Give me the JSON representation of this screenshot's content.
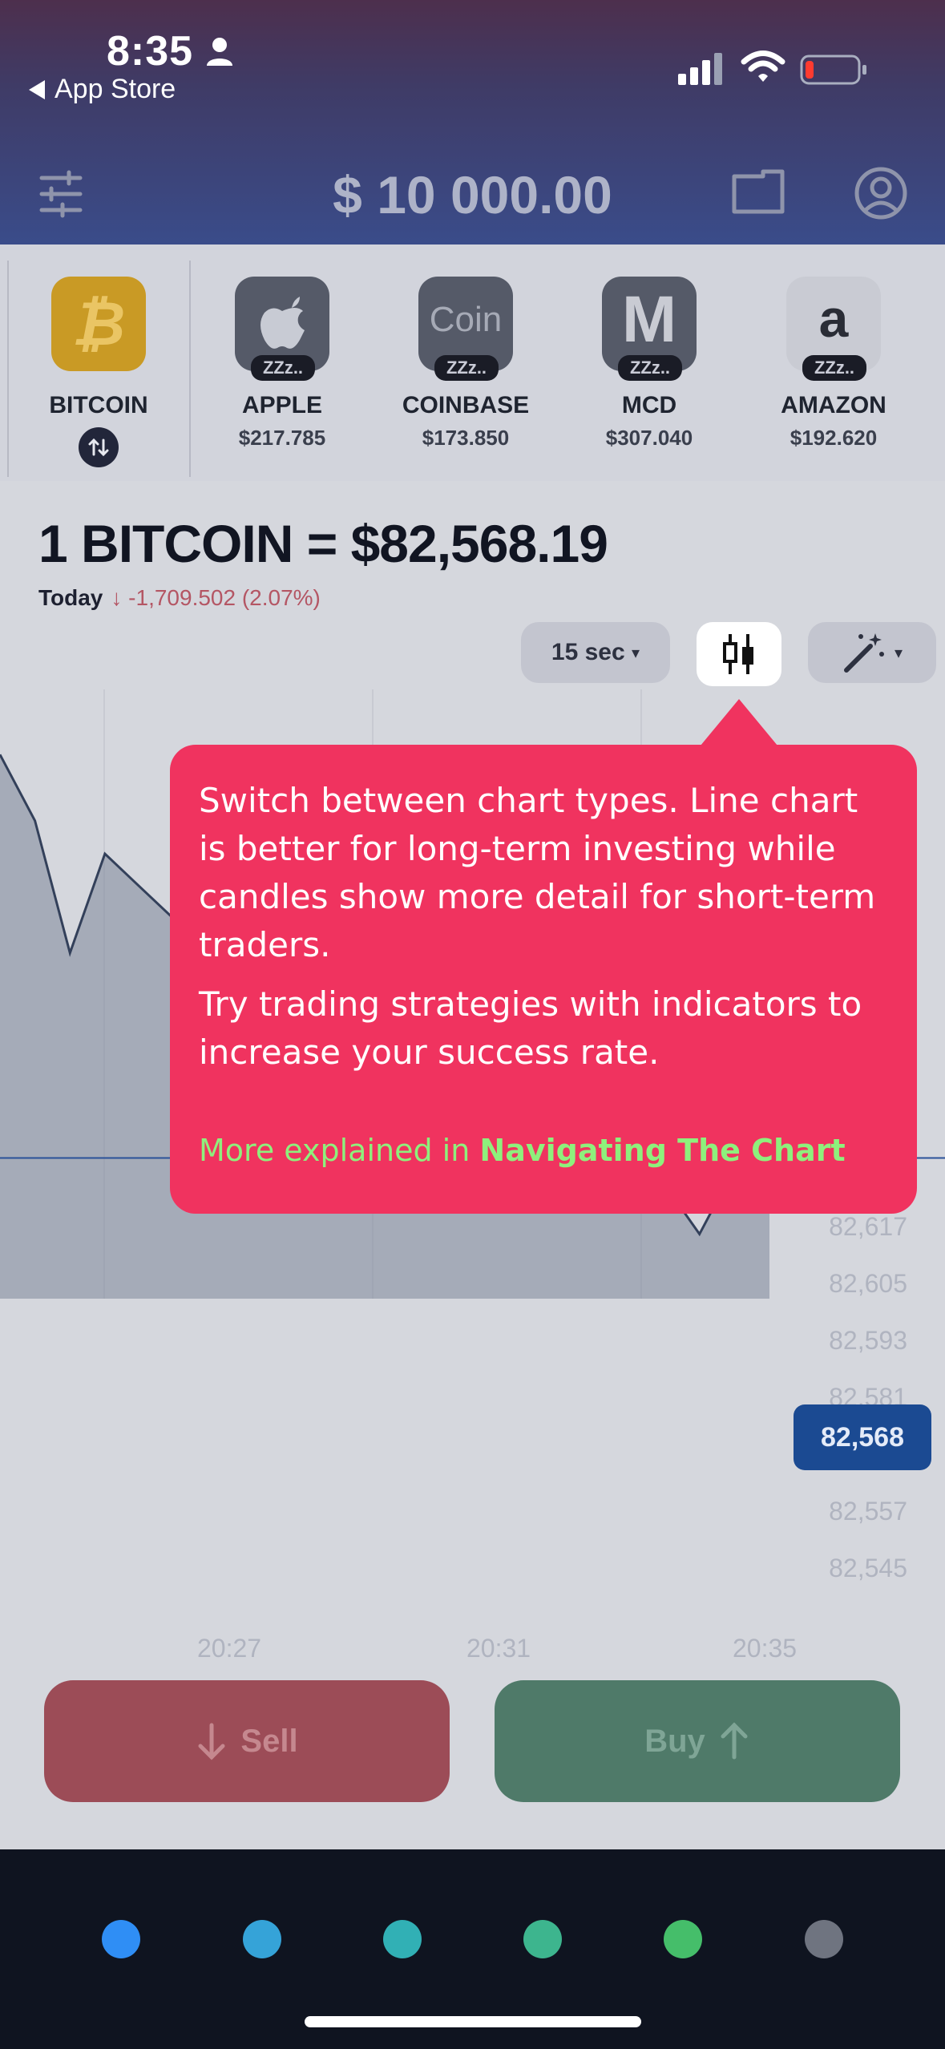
{
  "status_bar": {
    "time": "8:35",
    "back_label": "App Store"
  },
  "header": {
    "balance": "$ 10 000.00",
    "icons": [
      "sliders-icon",
      "folder-icon",
      "profile-icon"
    ]
  },
  "assets": [
    {
      "name": "BITCOIN",
      "price": "",
      "logo_text": "₿",
      "logo_color": "#d3a229",
      "sleeping": false,
      "zzz": ""
    },
    {
      "name": "APPLE",
      "price": "$217.785",
      "logo_text": "",
      "logo_color": "#555a68",
      "sleeping": true,
      "zzz": "ZZz.."
    },
    {
      "name": "COINBASE",
      "price": "$173.850",
      "logo_text": "Coin",
      "logo_color": "#555a68",
      "sleeping": true,
      "zzz": "ZZz.."
    },
    {
      "name": "MCD",
      "price": "$307.040",
      "logo_text": "M",
      "logo_color": "#555a68",
      "sleeping": true,
      "zzz": "ZZz.."
    },
    {
      "name": "AMAZON",
      "price": "$192.620",
      "logo_text": "a",
      "logo_color": "#c9cbd3",
      "sleeping": true,
      "zzz": "ZZz.."
    }
  ],
  "quote": {
    "headline": "1 BITCOIN =  $82,568.19",
    "today_label": "Today",
    "change": "↓ -1,709.502 (2.07%)"
  },
  "controls": {
    "timeframe": "15 sec",
    "timeframe_caret": "▾",
    "indicator_caret": "▾"
  },
  "chart_data": {
    "type": "line",
    "y_ticks": [
      "82,617",
      "82,605",
      "82,593",
      "82,581",
      "82,557",
      "82,545"
    ],
    "x_ticks": [
      "20:27",
      "20:31",
      "20:35"
    ],
    "last_value": "82,568",
    "ylim": [
      82540,
      82700
    ],
    "values": [
      82690,
      82670,
      82630,
      82660,
      82650,
      82640,
      82620,
      82640,
      82630,
      82610,
      82620,
      82600,
      82590,
      82605,
      82595,
      82610,
      82570,
      82580,
      82575,
      82560,
      82545,
      82565,
      82568
    ]
  },
  "tooltip": {
    "para1": "Switch between chart types. Line chart is better for long-term investing while candles show more detail for short-term traders.",
    "para2": "Try trading strategies with indicators to increase your success rate.",
    "more_prefix": "More explained in ",
    "more_link": "Navigating The Chart"
  },
  "trade": {
    "sell_label": "Sell",
    "buy_label": "Buy"
  },
  "bottom_nav": {
    "dot_colors": [
      "#2f8ef5",
      "#35a3d8",
      "#31b0b5",
      "#3db58e",
      "#45be6a",
      "#6f7480"
    ]
  }
}
